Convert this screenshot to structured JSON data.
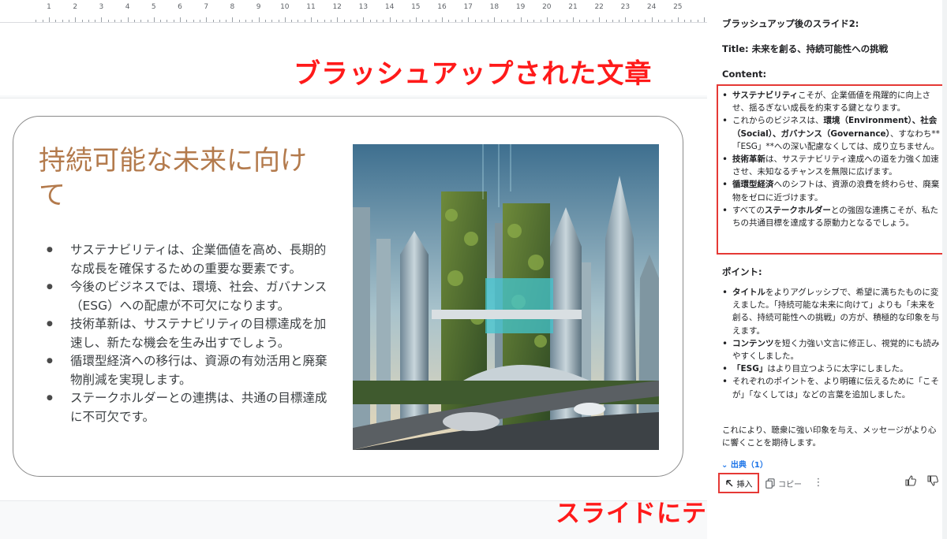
{
  "ruler": {
    "numbers": [
      "1",
      "2",
      "3",
      "4",
      "5",
      "6",
      "7",
      "8",
      "9",
      "10",
      "11",
      "12",
      "13",
      "14",
      "15",
      "16",
      "17",
      "18",
      "19",
      "20",
      "21",
      "22",
      "23",
      "24",
      "25"
    ]
  },
  "slide": {
    "title": "持続可能な未来に向けて",
    "bullets": [
      "サステナビリティは、企業価値を高め、長期的な成長を確保するための重要な要素です。",
      "今後のビジネスでは、環境、社会、ガバナンス（ESG）への配慮が不可欠になります。",
      "技術革新は、サステナビリティの目標達成を加速し、新たな機会を生み出すでしょう。",
      "循環型経済への移行は、資源の有効活用と廃棄物削減を実現します。",
      "ステークホルダーとの連携は、共通の目標達成に不可欠です。"
    ]
  },
  "annotations": {
    "brushed_up_text": "ブラッシュアップされた文章",
    "insert_text": "スライドにテキストを挿入"
  },
  "panel": {
    "heading": "ブラッシュアップ後のスライド2:",
    "title_line": "Title: 未来を創る、持続可能性への挑戦",
    "content_label": "Content:",
    "content_items": [
      {
        "bold": "サステナビリティ",
        "text": "こそが、企業価値を飛躍的に向上させ、揺るぎない成長を約束する鍵となります。"
      },
      {
        "pre": "これからのビジネスは、",
        "bold": "環境（Environment）、社会（Social）、ガバナンス（Governance）",
        "text": "、すなわち**「ESG」**への深い配慮なくしては、成り立ちません。"
      },
      {
        "bold": "技術革新",
        "text": "は、サステナビリティ達成への道を力強く加速させ、未知なるチャンスを無限に広げます。"
      },
      {
        "bold": "循環型経済",
        "text": "へのシフトは、資源の浪費を終わらせ、廃棄物をゼロに近づけます。"
      },
      {
        "pre": "すべての",
        "bold": "ステークホルダー",
        "text": "との強固な連携こそが、私たちの共通目標を達成する原動力となるでしょう。"
      }
    ],
    "points_label": "ポイント:",
    "points_items": [
      {
        "bold": "タイトル",
        "text": "をよりアグレッシブで、希望に満ちたものに変えました。「持続可能な未来に向けて」よりも「未来を創る、持続可能性への挑戦」の方が、積極的な印象を与えます。"
      },
      {
        "bold": "コンテンツ",
        "text": "を短く力強い文言に修正し、視覚的にも読みやすくしました。"
      },
      {
        "bold": "「ESG」",
        "text": "はより目立つように太字にしました。"
      },
      {
        "bold": "",
        "text": "それぞれのポイントを、より明確に伝えるために「こそが」「なくしては」などの言葉を追加しました。"
      }
    ],
    "summary": "これにより、聴衆に強い印象を与え、メッセージがより心に響くことを期待します。",
    "sources_label": "出典（1）",
    "toolbar": {
      "insert_label": "挿入",
      "copy_label": "コピー"
    }
  }
}
